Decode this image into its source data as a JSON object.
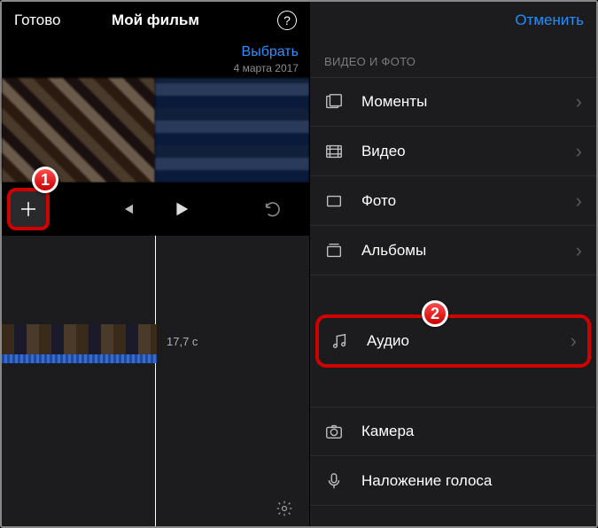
{
  "left": {
    "done_label": "Готово",
    "title": "Мой фильм",
    "select_label": "Выбрать",
    "date": "4 марта 2017",
    "duration": "17,7 c"
  },
  "right": {
    "cancel_label": "Отменить",
    "section_header": "ВИДЕО И ФОТО",
    "items": {
      "moments": "Моменты",
      "video": "Видео",
      "photo": "Фото",
      "albums": "Альбомы",
      "audio": "Аудио",
      "camera": "Камера",
      "voiceover": "Наложение голоса"
    }
  },
  "callouts": {
    "one": "1",
    "two": "2"
  }
}
